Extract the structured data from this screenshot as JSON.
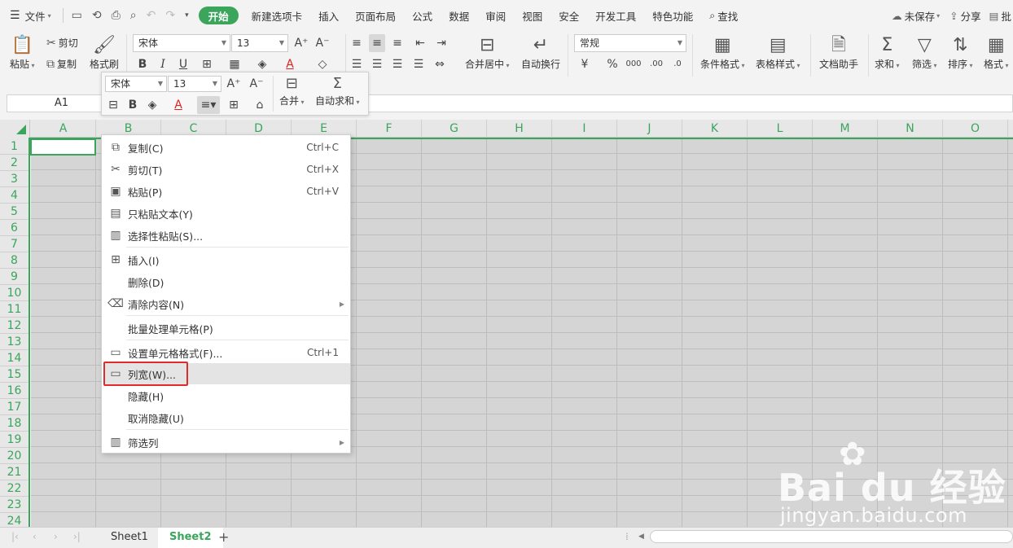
{
  "menubar": {
    "file": "文件",
    "tabs": [
      "开始",
      "新建选项卡",
      "插入",
      "页面布局",
      "公式",
      "数据",
      "审阅",
      "视图",
      "安全",
      "开发工具",
      "特色功能"
    ],
    "search": "查找",
    "unsaved": "未保存",
    "share": "分享",
    "batch": "批"
  },
  "ribbon": {
    "paste": "粘贴",
    "cut": "剪切",
    "copy": "复制",
    "format_painter": "格式刷",
    "font_name": "宋体",
    "font_size": "13",
    "merge_center": "合并居中",
    "auto_wrap": "自动换行",
    "number_format": "常规",
    "conditional_format": "条件格式",
    "table_style": "表格样式",
    "doc_helper": "文档助手",
    "sum": "求和",
    "filter": "筛选",
    "sort": "排序",
    "format": "格式"
  },
  "formula_bar": {
    "name_box": "A1"
  },
  "mini_toolbar": {
    "font_name": "宋体",
    "font_size": "13",
    "merge": "合并",
    "autosum": "自动求和"
  },
  "columns": [
    "A",
    "B",
    "C",
    "D",
    "E",
    "F",
    "G",
    "H",
    "I",
    "J",
    "K",
    "L",
    "M",
    "N",
    "O"
  ],
  "rows": [
    "1",
    "2",
    "3",
    "4",
    "5",
    "6",
    "7",
    "8",
    "9",
    "10",
    "11",
    "12",
    "13",
    "14",
    "15",
    "16",
    "17",
    "18",
    "19",
    "20",
    "21",
    "22",
    "23",
    "24"
  ],
  "context_menu": {
    "items": [
      {
        "label": "复制(C)",
        "shortcut": "Ctrl+C",
        "icon": "copy-icon"
      },
      {
        "label": "剪切(T)",
        "shortcut": "Ctrl+X",
        "icon": "scissors-icon"
      },
      {
        "label": "粘贴(P)",
        "shortcut": "Ctrl+V",
        "icon": "paste-icon"
      },
      {
        "label": "只粘贴文本(Y)",
        "shortcut": "",
        "icon": "paste-text-icon"
      },
      {
        "label": "选择性粘贴(S)...",
        "shortcut": "",
        "icon": "paste-special-icon"
      },
      {
        "label": "插入(I)",
        "shortcut": "",
        "icon": "insert-icon"
      },
      {
        "label": "删除(D)",
        "shortcut": "",
        "icon": ""
      },
      {
        "label": "清除内容(N)",
        "shortcut": "",
        "icon": "eraser-icon"
      },
      {
        "label": "批量处理单元格(P)",
        "shortcut": "",
        "icon": ""
      },
      {
        "label": "设置单元格格式(F)...",
        "shortcut": "Ctrl+1",
        "icon": "format-cells-icon"
      },
      {
        "label": "列宽(W)...",
        "shortcut": "",
        "icon": "column-width-icon"
      },
      {
        "label": "隐藏(H)",
        "shortcut": "",
        "icon": ""
      },
      {
        "label": "取消隐藏(U)",
        "shortcut": "",
        "icon": ""
      },
      {
        "label": "筛选列",
        "shortcut": "",
        "icon": "filter-column-icon"
      }
    ]
  },
  "sheets": [
    "Sheet1",
    "Sheet2"
  ],
  "active_sheet": "Sheet2",
  "watermark": {
    "brand": "Bai du 经验",
    "url": "jingyan.baidu.com"
  },
  "colors": {
    "accent": "#3ba55c",
    "highlight_box": "#e02b2b"
  }
}
